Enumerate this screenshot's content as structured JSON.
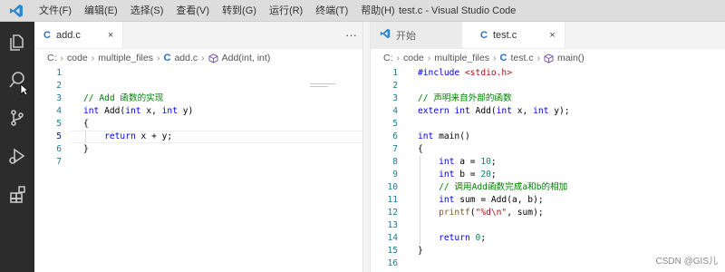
{
  "titlebar": {
    "menu": [
      "文件(F)",
      "编辑(E)",
      "选择(S)",
      "查看(V)",
      "转到(G)",
      "运行(R)",
      "终端(T)",
      "帮助(H)"
    ],
    "window_title": "test.c - Visual Studio Code"
  },
  "activity_bar": {
    "icons": [
      "files-icon",
      "search-icon",
      "source-control-icon",
      "run-debug-icon",
      "extensions-icon"
    ]
  },
  "left_editor": {
    "tab": {
      "icon": "C",
      "label": "add.c",
      "close": "×"
    },
    "more_actions": "···",
    "breadcrumb": [
      "C:",
      "code",
      "multiple_files",
      "add.c",
      "Add(int, int)"
    ],
    "lines": [
      {
        "n": "1",
        "tokens": []
      },
      {
        "n": "2",
        "tokens": []
      },
      {
        "n": "3",
        "tokens": [
          {
            "c": "cm",
            "t": "// Add 函数的实现"
          }
        ]
      },
      {
        "n": "4",
        "tokens": [
          {
            "c": "kw",
            "t": "int"
          },
          {
            "c": "",
            "t": " Add("
          },
          {
            "c": "kw",
            "t": "int"
          },
          {
            "c": "",
            "t": " x, "
          },
          {
            "c": "kw",
            "t": "int"
          },
          {
            "c": "",
            "t": " y)"
          }
        ]
      },
      {
        "n": "5",
        "tokens": [
          {
            "c": "",
            "t": "{"
          }
        ]
      },
      {
        "n": "5",
        "tokens": [
          {
            "c": "",
            "t": "    "
          },
          {
            "c": "kw",
            "t": "return"
          },
          {
            "c": "",
            "t": " x + y;"
          }
        ]
      },
      {
        "n": "6",
        "tokens": [
          {
            "c": "",
            "t": "}"
          }
        ]
      },
      {
        "n": "7",
        "tokens": []
      }
    ]
  },
  "right_editor": {
    "tabs": [
      {
        "icon": "vscode",
        "label": "开始",
        "active": false
      },
      {
        "icon": "C",
        "label": "test.c",
        "close": "×",
        "active": true
      }
    ],
    "breadcrumb": [
      "C:",
      "code",
      "multiple_files",
      "test.c",
      "main()"
    ],
    "lines": [
      {
        "n": "1",
        "tokens": [
          {
            "c": "pp",
            "t": "#include"
          },
          {
            "c": "",
            "t": " "
          },
          {
            "c": "str",
            "t": "<stdio.h>"
          }
        ]
      },
      {
        "n": "2",
        "tokens": []
      },
      {
        "n": "3",
        "tokens": [
          {
            "c": "cm",
            "t": "// 声明来自外部的函数"
          }
        ]
      },
      {
        "n": "4",
        "tokens": [
          {
            "c": "kw",
            "t": "extern"
          },
          {
            "c": "",
            "t": " "
          },
          {
            "c": "kw",
            "t": "int"
          },
          {
            "c": "",
            "t": " Add("
          },
          {
            "c": "kw",
            "t": "int"
          },
          {
            "c": "",
            "t": " x, "
          },
          {
            "c": "kw",
            "t": "int"
          },
          {
            "c": "",
            "t": " y);"
          }
        ]
      },
      {
        "n": "5",
        "tokens": []
      },
      {
        "n": "6",
        "tokens": [
          {
            "c": "kw",
            "t": "int"
          },
          {
            "c": "",
            "t": " main()"
          }
        ]
      },
      {
        "n": "7",
        "tokens": [
          {
            "c": "",
            "t": "{"
          }
        ]
      },
      {
        "n": "8",
        "tokens": [
          {
            "c": "",
            "t": "    "
          },
          {
            "c": "kw",
            "t": "int"
          },
          {
            "c": "",
            "t": " a = "
          },
          {
            "c": "num",
            "t": "10"
          },
          {
            "c": "",
            "t": ";"
          }
        ]
      },
      {
        "n": "9",
        "tokens": [
          {
            "c": "",
            "t": "    "
          },
          {
            "c": "kw",
            "t": "int"
          },
          {
            "c": "",
            "t": " b = "
          },
          {
            "c": "num",
            "t": "20"
          },
          {
            "c": "",
            "t": ";"
          }
        ]
      },
      {
        "n": "10",
        "tokens": [
          {
            "c": "",
            "t": "    "
          },
          {
            "c": "cm",
            "t": "// 调用Add函数完成a和b的相加"
          }
        ]
      },
      {
        "n": "11",
        "tokens": [
          {
            "c": "",
            "t": "    "
          },
          {
            "c": "kw",
            "t": "int"
          },
          {
            "c": "",
            "t": " sum = Add(a, b);"
          }
        ]
      },
      {
        "n": "12",
        "tokens": [
          {
            "c": "",
            "t": "    "
          },
          {
            "c": "fn",
            "t": "printf"
          },
          {
            "c": "",
            "t": "("
          },
          {
            "c": "str",
            "t": "\"%d\\n\""
          },
          {
            "c": "",
            "t": ", sum);"
          }
        ]
      },
      {
        "n": "13",
        "tokens": []
      },
      {
        "n": "14",
        "tokens": [
          {
            "c": "",
            "t": "    "
          },
          {
            "c": "kw",
            "t": "return"
          },
          {
            "c": "",
            "t": " "
          },
          {
            "c": "num",
            "t": "0"
          },
          {
            "c": "",
            "t": ";"
          }
        ]
      },
      {
        "n": "15",
        "tokens": [
          {
            "c": "",
            "t": "}"
          }
        ]
      },
      {
        "n": "16",
        "tokens": []
      }
    ]
  },
  "watermark": "CSDN @GIS儿"
}
